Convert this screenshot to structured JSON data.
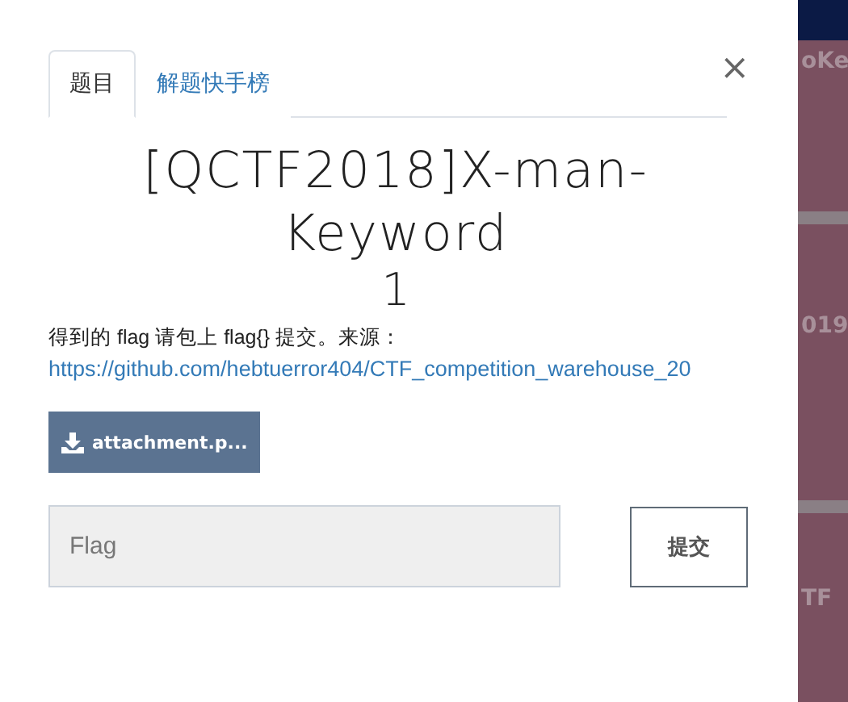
{
  "tabs": [
    {
      "label": "题目",
      "selected": true
    },
    {
      "label": "解题快手榜",
      "selected": false
    }
  ],
  "close": "×",
  "challenge": {
    "title": "[QCTF2018]X-man-Keyword",
    "score": "1",
    "description": "得到的 flag 请包上 flag{} 提交。来源：",
    "link": "https://github.com/hebtuerror404/CTF_competition_warehouse_20",
    "attachment": "attachment.p...",
    "flag_input": {
      "placeholder": "Flag"
    },
    "submit": "提交"
  },
  "background_fragments": [
    "oKe",
    "019",
    "TF"
  ]
}
